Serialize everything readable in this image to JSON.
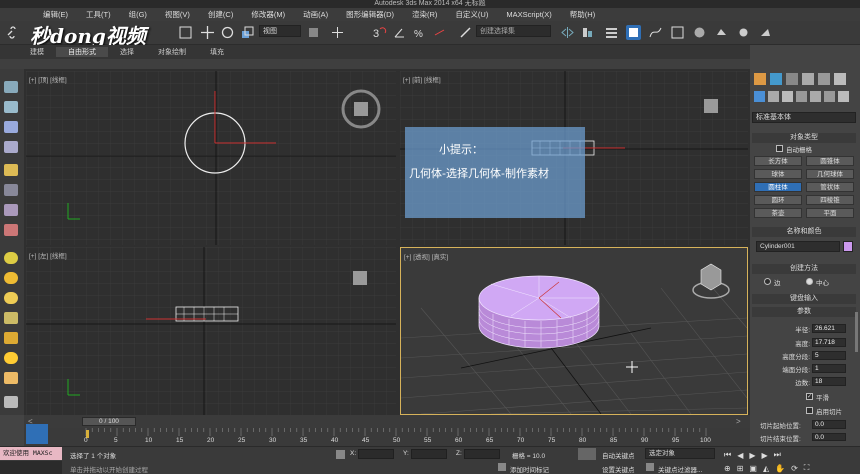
{
  "app": {
    "title": "Autodesk 3ds Max  2014 x64    无标题"
  },
  "menu": [
    "编辑(E)",
    "工具(T)",
    "组(G)",
    "视图(V)",
    "创建(C)",
    "修改器(M)",
    "动画(A)",
    "图形编辑器(D)",
    "渲染(R)",
    "自定义(U)",
    "MAXScript(X)",
    "帮助(H)"
  ],
  "watermark": {
    "text": "秒dong视频"
  },
  "toolbar": {
    "view_dropdown": "视图",
    "selection_set": "创建选择集"
  },
  "ribbon": {
    "tabs": [
      "建模",
      "自由形式",
      "选择",
      "对象绘制",
      "填充"
    ],
    "active": 1
  },
  "viewports": {
    "top": "[+] [顶] [线框]",
    "front": "[+] [前] [线框]",
    "left": "[+] [左] [线框]",
    "persp": "[+] [透视] [真实]"
  },
  "tip": {
    "title": "小提示：",
    "body": "几何体-选择几何体-制作素材"
  },
  "command_panel": {
    "dropdown": "标准基本体",
    "object_type_title": "对象类型",
    "autogrid": "自动栅格",
    "objects": [
      "长方体",
      "圆锥体",
      "球体",
      "几何球体",
      "圆柱体",
      "管状体",
      "圆环",
      "四棱锥",
      "茶壶",
      "平面"
    ],
    "selected_object": "圆柱体",
    "name_color_title": "名称和颜色",
    "object_name": "Cylinder001",
    "object_color": "#cc99ee",
    "creation_method_title": "创建方法",
    "edge_label": "边",
    "center_label": "中心",
    "keyboard_entry_title": "键盘输入",
    "params_title": "参数",
    "radius_label": "半径:",
    "radius": "26.621",
    "height_label": "高度:",
    "height": "17.718",
    "height_segs_label": "高度分段:",
    "height_segs": "5",
    "cap_segs_label": "端面分段:",
    "cap_segs": "1",
    "sides_label": "边数:",
    "sides": "18",
    "smooth_label": "平滑",
    "slice_label": "启用切片",
    "slice_from_label": "切片起始位置:",
    "slice_from": "0.0",
    "slice_to_label": "切片结束位置:",
    "slice_to": "0.0"
  },
  "timeline": {
    "position": "0 / 100",
    "ticks": [
      "0",
      "5",
      "10",
      "15",
      "20",
      "25",
      "30",
      "35",
      "40",
      "45",
      "50",
      "55",
      "60",
      "65",
      "70",
      "75",
      "80",
      "85",
      "90",
      "95",
      "100"
    ]
  },
  "status": {
    "welcome": "欢迎使用 MAXSc",
    "selected": "选择了 1 个对象",
    "hint": "单击并拖动以开始创建过程",
    "x_label": "X:",
    "y_label": "Y:",
    "z_label": "Z:",
    "grid": "栅格 = 10.0",
    "auto_key": "自动关键点",
    "set_key": "设置关键点",
    "key_mode": "选定对象",
    "key_filters": "关键点过滤器...",
    "add_time_tag": "添加时间标记"
  },
  "colors": {
    "accent": "#2f6fb6",
    "cylinder": "#c9a0f0",
    "viewport_bg": "#2f2f2f",
    "active_border": "#d6b25a"
  }
}
